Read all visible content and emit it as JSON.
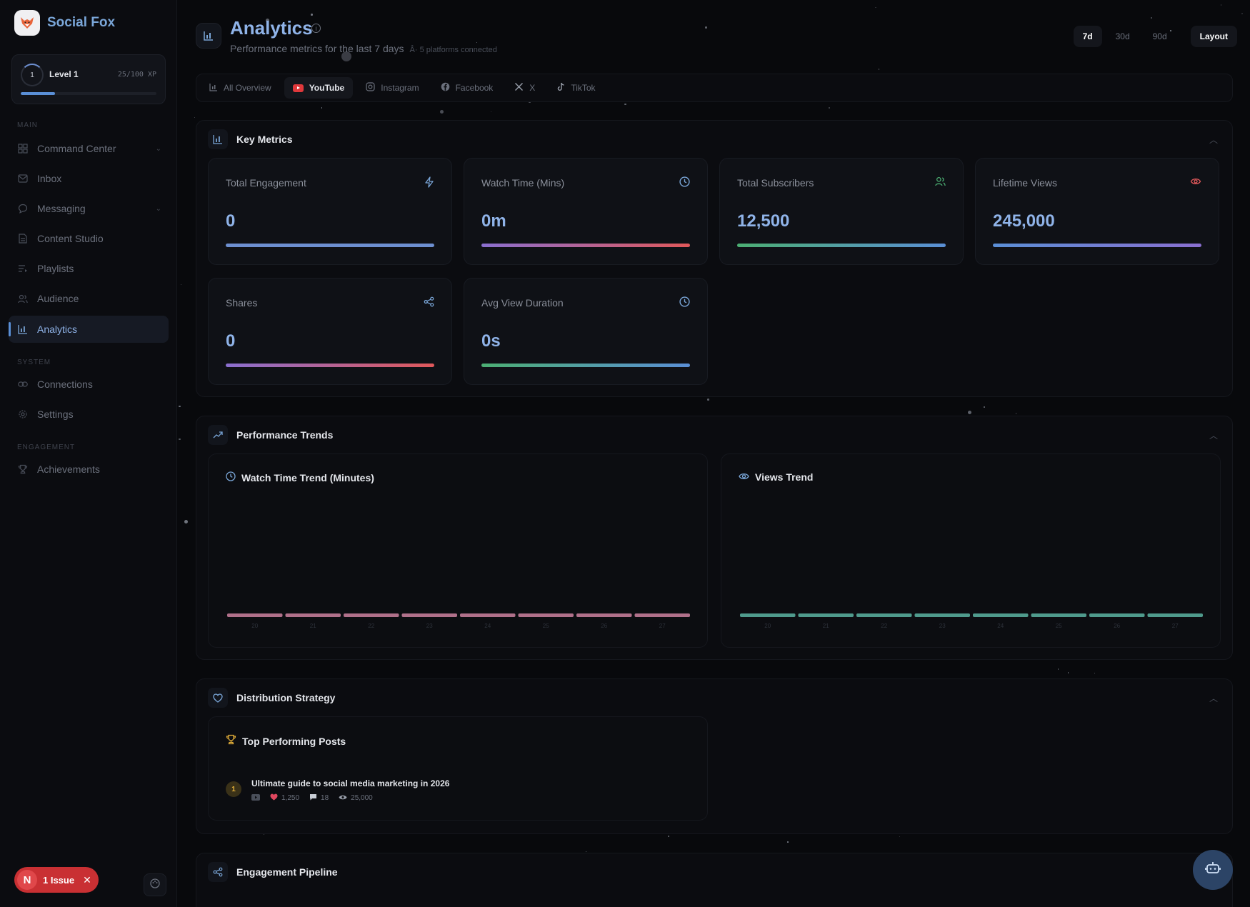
{
  "brand": {
    "name": "Social Fox",
    "logo_icon": "fox-icon"
  },
  "level": {
    "ring_label": "1",
    "name": "Level 1",
    "xp": "25/100 XP",
    "progress": 0.25
  },
  "nav": {
    "main_label": "MAIN",
    "system_label": "SYSTEM",
    "engagement_label": "ENGAGEMENT",
    "items": [
      {
        "label": "Command Center",
        "icon": "grid-icon",
        "chevron": true
      },
      {
        "label": "Inbox",
        "icon": "mail-icon"
      },
      {
        "label": "Messaging",
        "icon": "chat-icon",
        "chevron": true
      },
      {
        "label": "Content Studio",
        "icon": "document-icon"
      },
      {
        "label": "Playlists",
        "icon": "playlist-icon"
      },
      {
        "label": "Audience",
        "icon": "users-icon"
      },
      {
        "label": "Analytics",
        "icon": "bar-chart-icon",
        "active": true
      },
      {
        "label": "Connections",
        "icon": "link-icon"
      },
      {
        "label": "Settings",
        "icon": "gear-icon"
      },
      {
        "label": "Achievements",
        "icon": "trophy-icon"
      }
    ]
  },
  "issue": {
    "letter": "N",
    "label": "1 Issue"
  },
  "header": {
    "title": "Analytics",
    "subtitle": "Performance metrics for the last 7 days",
    "platforms": "Â· 5 platforms connected",
    "ranges": [
      "7d",
      "30d",
      "90d"
    ],
    "active_range": "7d",
    "layout_label": "Layout"
  },
  "tabs": [
    {
      "label": "All Overview",
      "icon": "bar-chart-icon"
    },
    {
      "label": "YouTube",
      "icon": "youtube-icon",
      "active": true
    },
    {
      "label": "Instagram",
      "icon": "instagram-icon"
    },
    {
      "label": "Facebook",
      "icon": "facebook-icon"
    },
    {
      "label": "X",
      "icon": "x-icon"
    },
    {
      "label": "TikTok",
      "icon": "tiktok-icon"
    }
  ],
  "key_metrics": {
    "title": "Key Metrics",
    "cards": [
      {
        "label": "Total Engagement",
        "value": "0",
        "icon": "bolt-icon",
        "bar": [
          "#6d8fd0",
          "#6d8fd0"
        ]
      },
      {
        "label": "Watch Time (Mins)",
        "value": "0m",
        "icon": "clock-icon",
        "bar": [
          "#8a6fd0",
          "#e0585a"
        ]
      },
      {
        "label": "Total Subscribers",
        "value": "12,500",
        "icon": "users-icon",
        "bar": [
          "#4caf73",
          "#5a8fd6"
        ]
      },
      {
        "label": "Lifetime Views",
        "value": "245,000",
        "icon": "eye-icon",
        "bar": [
          "#5a8fd6",
          "#8a6fd0"
        ]
      },
      {
        "label": "Shares",
        "value": "0",
        "icon": "share-icon",
        "bar": [
          "#8a6fd0",
          "#e0585a"
        ]
      },
      {
        "label": "Avg View Duration",
        "value": "0s",
        "icon": "clock-icon",
        "bar": [
          "#4caf73",
          "#5a8fd6"
        ]
      }
    ]
  },
  "trends": {
    "title": "Performance Trends",
    "watch_title": "Watch Time Trend (Minutes)",
    "views_title": "Views Trend"
  },
  "chart_data": [
    {
      "type": "bar",
      "title": "Watch Time Trend (Minutes)",
      "categories": [
        "20",
        "21",
        "22",
        "23",
        "24",
        "25",
        "26",
        "27"
      ],
      "values": [
        0,
        0,
        0,
        0,
        0,
        0,
        0,
        0
      ],
      "color": "#b0708a"
    },
    {
      "type": "bar",
      "title": "Views Trend",
      "categories": [
        "20",
        "21",
        "22",
        "23",
        "24",
        "25",
        "26",
        "27"
      ],
      "values": [
        0,
        0,
        0,
        0,
        0,
        0,
        0,
        0
      ],
      "color": "#4f9a8c"
    }
  ],
  "distribution": {
    "title": "Distribution Strategy",
    "top_posts_title": "Top Performing Posts",
    "post": {
      "rank": "1",
      "title": "Ultimate guide to social media marketing in 2026",
      "likes": "1,250",
      "comments": "18",
      "views": "25,000"
    }
  },
  "pipeline": {
    "title": "Engagement Pipeline"
  },
  "colors": {
    "accent": "#7aa6d8",
    "issue": "#c93033",
    "gold": "#e8b23a"
  }
}
